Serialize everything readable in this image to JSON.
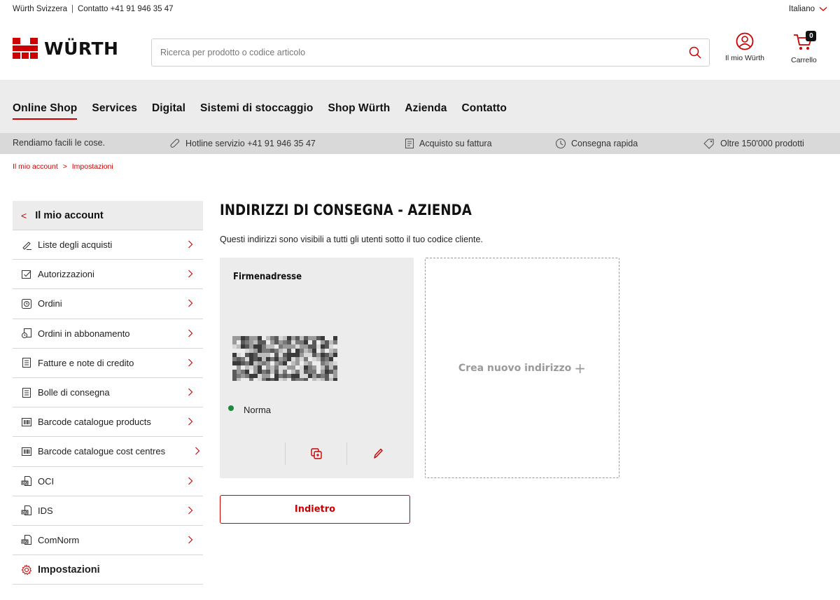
{
  "topbar": {
    "company": "Würth Svizzera",
    "contact": "Contatto +41 91 946 35 47",
    "language": "Italiano"
  },
  "header": {
    "logo_text": "WÜRTH",
    "search_placeholder": "Ricerca per prodotto o codice articolo",
    "account_label": "Il mio Würth",
    "cart_label": "Carrello",
    "cart_count": "0"
  },
  "nav": {
    "items": [
      {
        "label": "Online Shop"
      },
      {
        "label": "Services"
      },
      {
        "label": "Digital"
      },
      {
        "label": "Sistemi di stoccaggio"
      },
      {
        "label": "Shop Würth"
      },
      {
        "label": "Azienda"
      },
      {
        "label": "Contatto"
      }
    ]
  },
  "usp": {
    "slogan": "Rendiamo facili le cose.",
    "hotline": "Hotline servizio +41 91 946 35 47",
    "invoice": "Acquisto su fattura",
    "delivery": "Consegna rapida",
    "products": "Oltre 150'000 prodotti"
  },
  "breadcrumb": {
    "account": "Il mio account",
    "sep": ">",
    "current": "Impostazioni"
  },
  "sidebar": {
    "header": "Il mio account",
    "items": [
      {
        "label": "Liste degli acquisti"
      },
      {
        "label": "Autorizzazioni"
      },
      {
        "label": "Ordini"
      },
      {
        "label": "Ordini in abbonamento"
      },
      {
        "label": "Fatture e note di credito"
      },
      {
        "label": "Bolle di consegna"
      },
      {
        "label": "Barcode catalogue products"
      },
      {
        "label": "Barcode catalogue cost centres"
      },
      {
        "label": "OCI"
      },
      {
        "label": "IDS"
      },
      {
        "label": "ComNorm"
      },
      {
        "label": "Impostazioni"
      }
    ]
  },
  "content": {
    "title": "INDIRIZZI DI CONSEGNA - AZIENDA",
    "description": "Questi indirizzi sono visibili a tutti gli utenti sotto il tuo codice cliente.",
    "address_card": {
      "name": "Firmenadresse",
      "status": "Norma"
    },
    "new_address_label": "Crea nuovo indirizzo",
    "back_button": "Indietro"
  },
  "colors": {
    "brand_red": "#cc0000",
    "status_green": "#1a8a3c"
  }
}
